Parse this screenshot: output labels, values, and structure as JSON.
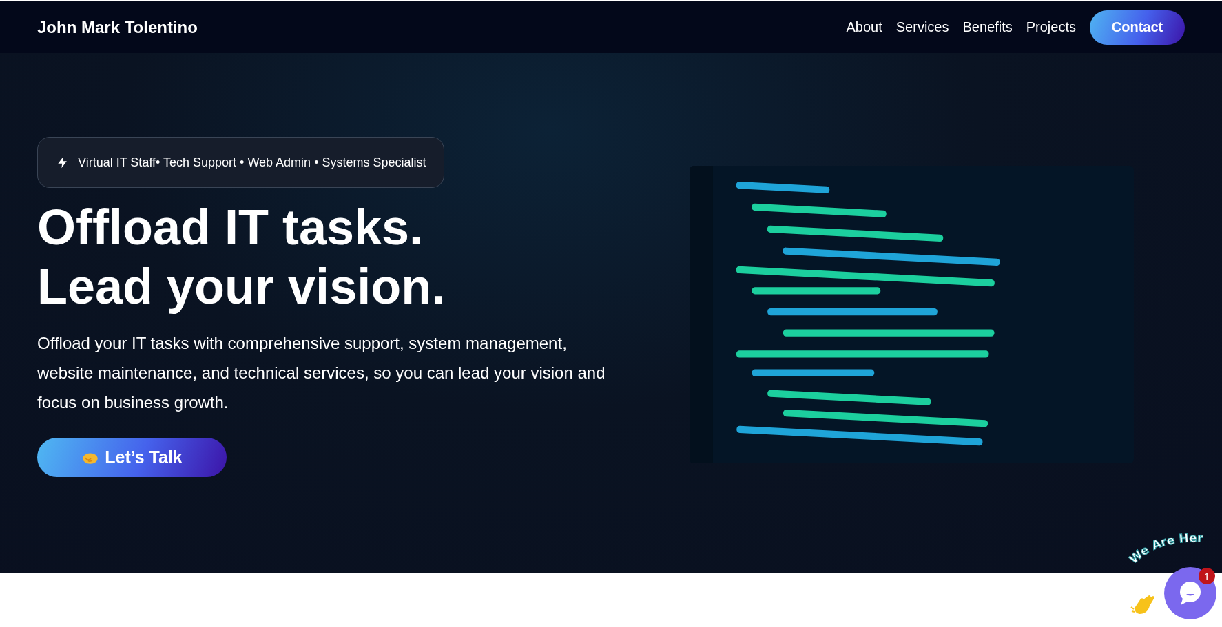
{
  "header": {
    "brand": "John Mark Tolentino",
    "nav": [
      {
        "label": "About"
      },
      {
        "label": "Services"
      },
      {
        "label": "Benefits"
      },
      {
        "label": "Projects"
      }
    ],
    "cta": "Contact"
  },
  "hero": {
    "tagline": "Virtual IT Staff• Tech Support • Web Admin • Systems Specialist",
    "heading": [
      "Offload IT tasks.",
      "Lead your vision."
    ],
    "text": "Offload your IT tasks with comprehensive support, system management, website maintenance, and technical services, so you can lead your vision and focus on business growth.",
    "button": "Let’s Talk"
  },
  "chat_widget": {
    "caption": "We Are Her",
    "badge": "1"
  }
}
